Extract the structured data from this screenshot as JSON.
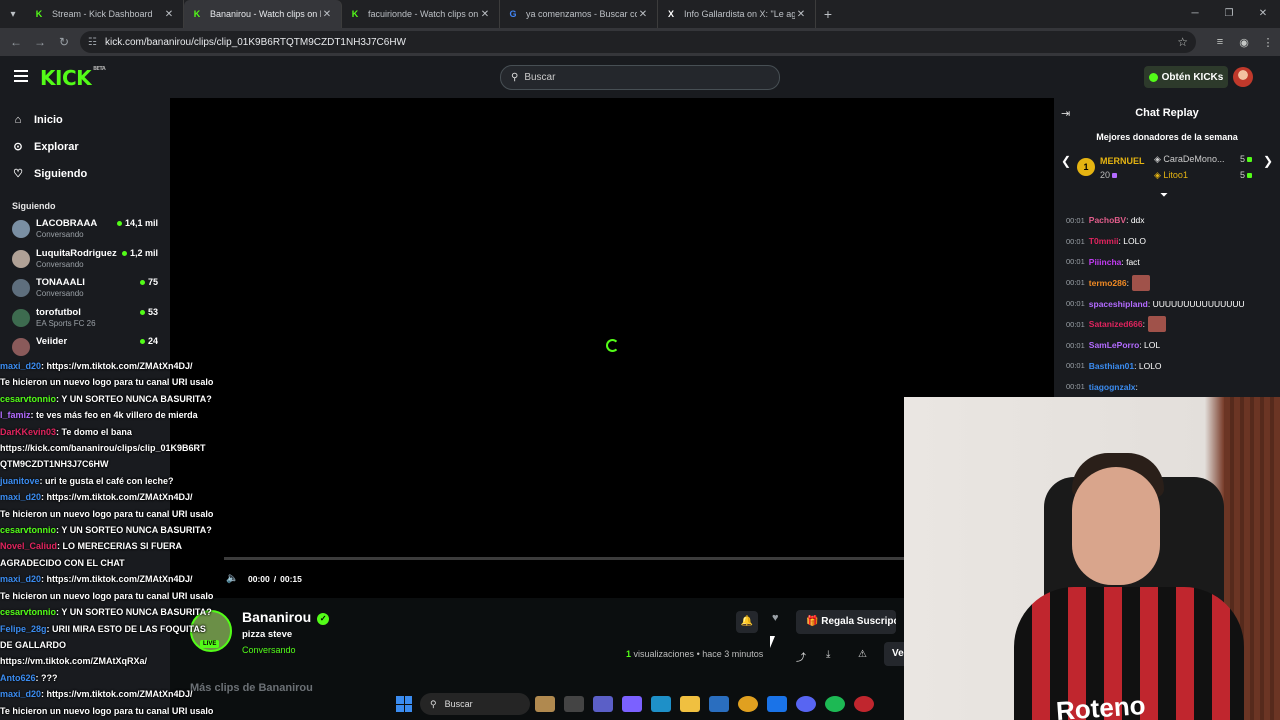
{
  "browser": {
    "tabs": [
      {
        "title": "Stream - Kick Dashboard",
        "color": "#53fc18",
        "icon": "kick-icon"
      },
      {
        "title": "Bananirou - Watch clips on Kick",
        "color": "#53fc18",
        "icon": "kick-icon"
      },
      {
        "title": "facuirionde - Watch clips on Ki",
        "color": "#53fc18",
        "icon": "kick-icon"
      },
      {
        "title": "ya comenzamos - Buscar con G",
        "color": "#4285f4",
        "icon": "google-icon"
      },
      {
        "title": "Info Gallardista on X: \"Le agra",
        "color": "#ffffff",
        "icon": "x-icon"
      }
    ],
    "url": "kick.com/bananirou/clips/clip_01K9B6RTQTM9CZDT1NH3J7C6HW"
  },
  "header": {
    "logo": "KICK",
    "logo_badge": "BETA",
    "search_placeholder": "Buscar",
    "kicks_button": "Obtén KICKs"
  },
  "sidebar": {
    "nav": [
      {
        "label": "Inicio",
        "icon": "home-icon"
      },
      {
        "label": "Explorar",
        "icon": "compass-icon"
      },
      {
        "label": "Siguiendo",
        "icon": "heart-icon"
      }
    ],
    "following_title": "Siguiendo",
    "following": [
      {
        "name": "LACOBRAAA",
        "category": "Conversando",
        "viewers": "14,1 mil",
        "color": "#7a8fa3"
      },
      {
        "name": "LuquitaRodriguez",
        "category": "Conversando",
        "viewers": "1,2 mil",
        "color": "#b0a196"
      },
      {
        "name": "TONAAALI",
        "category": "Conversando",
        "viewers": "75",
        "color": "#5e6e7d"
      },
      {
        "name": "torofutbol",
        "category": "EA Sports FC 26",
        "viewers": "53",
        "color": "#3d6b4f"
      },
      {
        "name": "Veiider",
        "category": "",
        "viewers": "24",
        "color": "#8a5a5a"
      }
    ]
  },
  "video": {
    "time_current": "00:00",
    "time_total": "00:15",
    "progress": 0
  },
  "clip": {
    "streamer": "Bananirou",
    "title": "pizza steve",
    "category": "Conversando",
    "live_badge": "LIVE",
    "gift_button": "Regala Suscripc",
    "views_count": "1",
    "views_label": "visualizaciones",
    "time_ago": "• hace 3 minutos",
    "ver_button": "Ve",
    "more_clips": "Más clips de Bananirou"
  },
  "chat": {
    "title": "Chat Replay",
    "donors_title": "Mejores donadores de la semana",
    "donors": [
      {
        "name": "MERNUEL",
        "amount": "20",
        "rank": "1"
      },
      {
        "name": "CaraDeMono...",
        "amount": "5"
      },
      {
        "name": "Litoo1",
        "amount": "5"
      }
    ],
    "messages": [
      {
        "time": "00:01",
        "user": "PachoBV",
        "color": "#e05d8a",
        "text": ": ddx"
      },
      {
        "time": "00:01",
        "user": "T0mmii",
        "color": "#e0245e",
        "text": ": LOLO"
      },
      {
        "time": "00:01",
        "user": "Piiincha",
        "color": "#c03cf0",
        "text": ": fact"
      },
      {
        "time": "00:01",
        "user": "termo286",
        "color": "#f08a24",
        "text": ":",
        "emote": true
      },
      {
        "time": "00:01",
        "user": "spaceshipland",
        "color": "#b36bff",
        "text": ": UUUUUUUUUUUUUUU"
      },
      {
        "time": "00:01",
        "user": "Satanized666",
        "color": "#e0245e",
        "text": ":",
        "emote": true
      },
      {
        "time": "00:01",
        "user": "SamLePorro",
        "color": "#b36bff",
        "text": ": LOL"
      },
      {
        "time": "00:01",
        "user": "Basthian01",
        "color": "#3b8cf0",
        "text": ": LOLO"
      },
      {
        "time": "00:01",
        "user": "tiagognzalx",
        "color": "#3b8cf0",
        "text": ":"
      }
    ]
  },
  "overlay_chat": [
    {
      "user": "maxi_d20",
      "color": "#3b8cf0",
      "text": ": https://vm.tiktok.com/ZMAtXn4DJ/"
    },
    {
      "user": "",
      "color": "#fff",
      "text": "Te hicieron un nuevo logo para tu canal URI usalo"
    },
    {
      "user": "cesarvtonnio",
      "color": "#53fc18",
      "text": ": Y UN SORTEO NUNCA BASURITA?"
    },
    {
      "user": "l_famiz",
      "color": "#b36bff",
      "text": ": te ves más feo en 4k villero de mierda"
    },
    {
      "user": "DarKKevin03",
      "color": "#e0245e",
      "text": ": Te domo el bana"
    },
    {
      "user": "",
      "color": "#fff",
      "text": "https://kick.com/bananirou/clips/clip_01K9B6RT"
    },
    {
      "user": "",
      "color": "#fff",
      "text": "QTM9CZDT1NH3J7C6HW"
    },
    {
      "user": "juanitove",
      "color": "#3b8cf0",
      "text": ": uri te gusta el café con leche?"
    },
    {
      "user": "maxi_d20",
      "color": "#3b8cf0",
      "text": ": https://vm.tiktok.com/ZMAtXn4DJ/"
    },
    {
      "user": "",
      "color": "#fff",
      "text": "Te hicieron un nuevo logo para tu canal URI usalo"
    },
    {
      "user": "cesarvtonnio",
      "color": "#53fc18",
      "text": ": Y UN SORTEO NUNCA BASURITA?"
    },
    {
      "user": "Novel_Caliud",
      "color": "#e0245e",
      "text": ": LO MERECERIAS SI FUERA"
    },
    {
      "user": "",
      "color": "#fff",
      "text": "AGRADECIDO CON EL CHAT"
    },
    {
      "user": "maxi_d20",
      "color": "#3b8cf0",
      "text": ": https://vm.tiktok.com/ZMAtXn4DJ/"
    },
    {
      "user": "",
      "color": "#fff",
      "text": "Te hicieron un nuevo logo para tu canal URI usalo"
    },
    {
      "user": "cesarvtonnio",
      "color": "#53fc18",
      "text": ": Y UN SORTEO NUNCA BASURITA?"
    },
    {
      "user": "Felipe_28g",
      "color": "#3b8cf0",
      "text": ": URII MIRA ESTO DE LAS FOQUITAS"
    },
    {
      "user": "",
      "color": "#fff",
      "text": "DE GALLARDO"
    },
    {
      "user": "",
      "color": "#fff",
      "text": "https://vm.tiktok.com/ZMAtXqRXa/"
    },
    {
      "user": "Anto626",
      "color": "#3b8cf0",
      "text": ": ???"
    },
    {
      "user": "maxi_d20",
      "color": "#3b8cf0",
      "text": ": https://vm.tiktok.com/ZMAtXn4DJ/"
    },
    {
      "user": "",
      "color": "#fff",
      "text": "Te hicieron un nuevo logo para tu canal URI usalo"
    }
  ],
  "webcam": {
    "shirt_text": "Roteno"
  },
  "taskbar": {
    "search_placeholder": "Buscar"
  }
}
